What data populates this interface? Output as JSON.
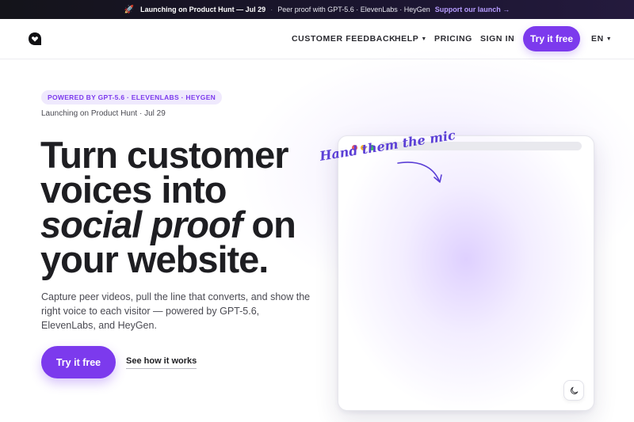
{
  "announcement": {
    "icon": "rocket-icon",
    "launch": "Launching on Product Hunt — Jul 29",
    "separator": "·",
    "proof": "Peer proof with GPT-5.6 · ElevenLabs · HeyGen",
    "support": "Support our launch →"
  },
  "header": {
    "nav": {
      "feedback": "CUSTOMER FEEDBACK",
      "help": "HELP",
      "pricing": "PRICING",
      "sign_in": "SIGN IN",
      "try_free": "Try it free",
      "language": "EN"
    }
  },
  "hero": {
    "badge": "POWERED BY GPT-5.6 · ELEVENLABS · HEYGEN",
    "launch_note": "Launching on Product Hunt · Jul 29",
    "headline": {
      "line1": "Turn customer",
      "line2": "voices into",
      "line3_italic": "social proof",
      "line3_rest": " on",
      "line4": "your website."
    },
    "description": "Capture peer videos, pull the line that converts, and show the right voice to each visitor — powered by GPT-5.6, ElevenLabs, and HeyGen.",
    "cta_primary": "Try it free",
    "cta_secondary": "See how it works"
  },
  "mockup": {
    "annotation": "Hand them the mic"
  },
  "colors": {
    "accent": "#7c3aed",
    "annotation": "#5b3fd6",
    "announce_bg": "#14141a"
  }
}
